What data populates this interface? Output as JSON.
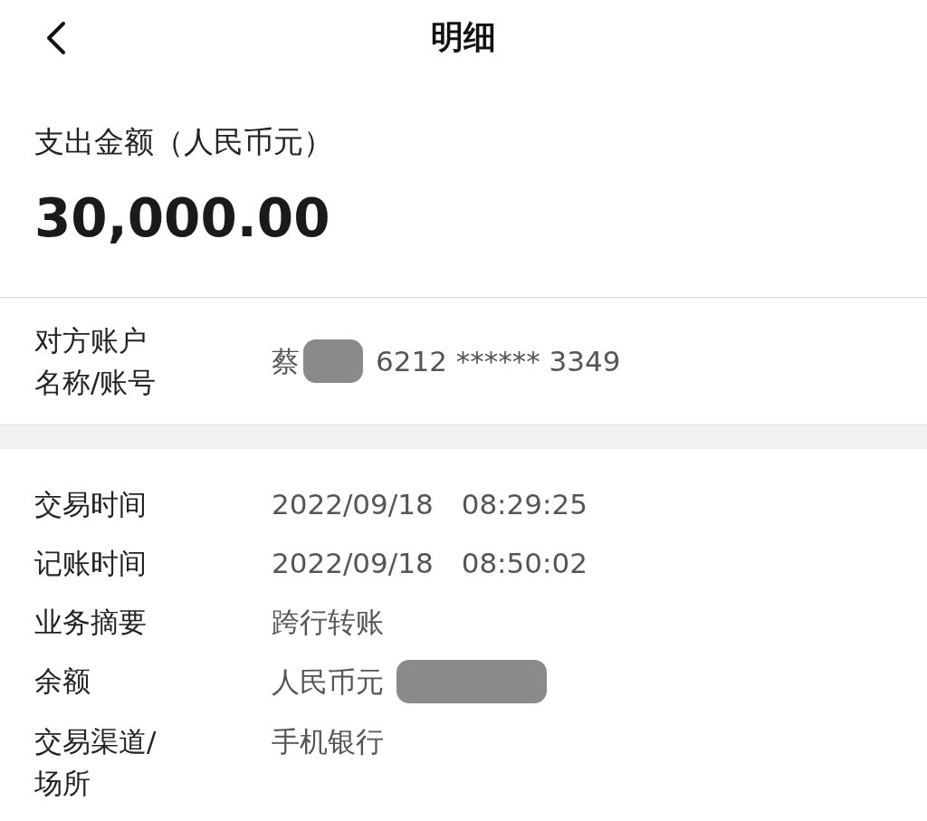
{
  "header": {
    "title": "明细"
  },
  "amount_section": {
    "label": "支出金额（人民币元）",
    "amount": "30,000.00"
  },
  "counterparty": {
    "label_lines": [
      "对方账户",
      "名称/账号"
    ],
    "name": "蔡",
    "name_redacted": true,
    "account": "6212 ****** 3349"
  },
  "details": [
    {
      "label_lines": [
        "交易时间"
      ],
      "value": "2022/09/18　08:29:25",
      "redacted": false
    },
    {
      "label_lines": [
        "记账时间"
      ],
      "value": "2022/09/18　08:50:02",
      "redacted": false
    },
    {
      "label_lines": [
        "业务摘要"
      ],
      "value": "跨行转账",
      "redacted": false
    },
    {
      "label_lines": [
        "余额"
      ],
      "value": "人民币元",
      "redacted": true
    },
    {
      "label_lines": [
        "交易渠道/",
        "场所"
      ],
      "value": "手机银行",
      "redacted": false
    }
  ]
}
